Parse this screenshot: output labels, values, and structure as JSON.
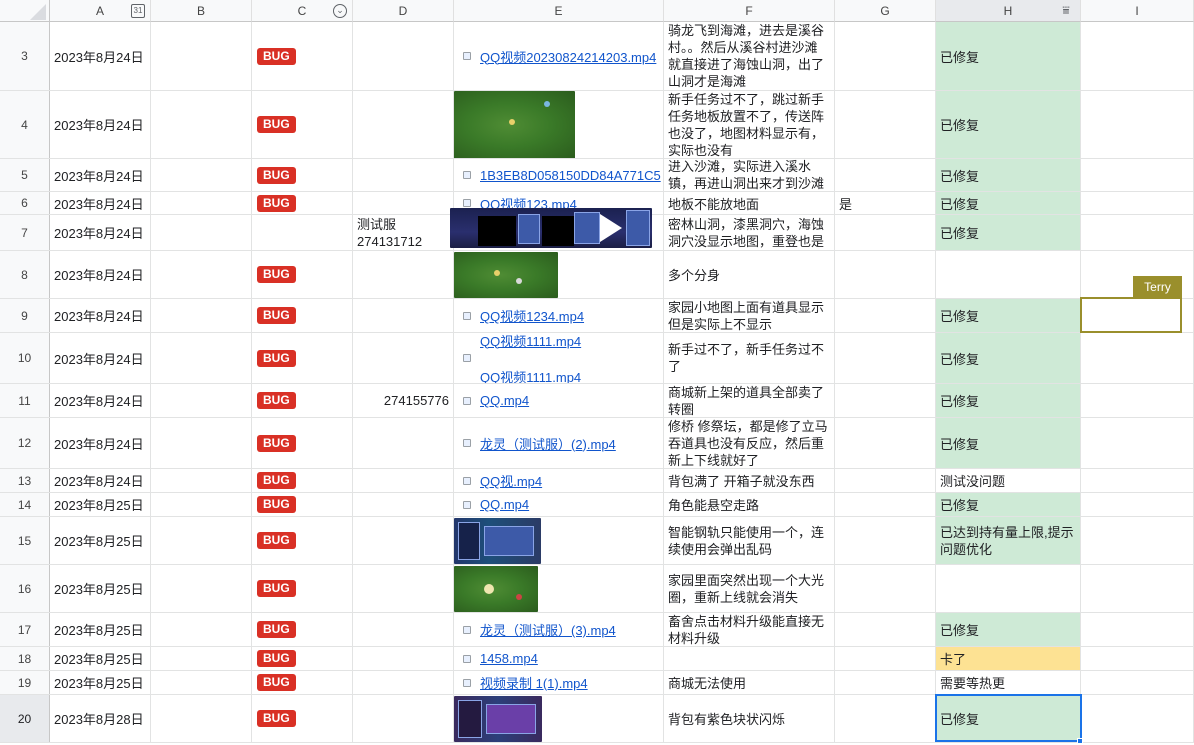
{
  "columns": [
    "A",
    "B",
    "C",
    "D",
    "E",
    "F",
    "G",
    "H",
    "I"
  ],
  "icons": {
    "corner": "select-all-icon",
    "col_a": "calendar-icon",
    "col_c": "chevron-down-icon",
    "col_h": "filter-icon",
    "file": "file-chip-icon"
  },
  "colors": {
    "bug": "#d93025",
    "fixed_green": "#ceead6",
    "stuck_yellow": "#fde293",
    "link": "#1155cc",
    "collab_olive": "#9a8f2c",
    "selection_blue": "#1a73e8"
  },
  "collaborator": {
    "name": "Terry"
  },
  "rows": [
    {
      "num": "3",
      "date": "2023年8月24日",
      "tag": "BUG",
      "d": "",
      "files": [
        "QQ视频20230824214203.mp4"
      ],
      "desc": "骑龙飞到海滩，进去是溪谷村。。然后从溪谷村进沙滩就直接进了海蚀山洞，出了山洞才是海滩",
      "g": "",
      "status": "已修复"
    },
    {
      "num": "4",
      "date": "2023年8月24日",
      "tag": "BUG",
      "d": "",
      "files": [],
      "desc": "新手任务过不了，跳过新手任务地板放置不了，传送阵也没了，地图材料显示有，实际也没有",
      "g": "",
      "status": "已修复"
    },
    {
      "num": "5",
      "date": "2023年8月24日",
      "tag": "BUG",
      "d": "",
      "files": [
        "1B3EB8D058150DD84A771C5"
      ],
      "desc": "进入沙滩，实际进入溪水镇，再进山洞出来才到沙滩",
      "g": "",
      "status": "已修复"
    },
    {
      "num": "6",
      "date": "2023年8月24日",
      "tag": "BUG",
      "d": "",
      "files": [
        "QQ视频123.mp4"
      ],
      "desc": "地板不能放地面",
      "g": "是",
      "status": "已修复"
    },
    {
      "num": "7",
      "date": "2023年8月24日",
      "tag": "",
      "d": "测试服 274131712",
      "files": [],
      "desc": "密林山洞，漆黑洞穴，海蚀洞穴没显示地图，重登也是",
      "g": "",
      "status": "已修复"
    },
    {
      "num": "8",
      "date": "2023年8月24日",
      "tag": "BUG",
      "d": "",
      "files": [],
      "desc": "多个分身",
      "g": "",
      "status": ""
    },
    {
      "num": "9",
      "date": "2023年8月24日",
      "tag": "BUG",
      "d": "",
      "files": [
        "QQ视频1234.mp4"
      ],
      "desc": "家园小地图上面有道具显示但是实际上不显示",
      "g": "",
      "status": "已修复"
    },
    {
      "num": "10",
      "date": "2023年8月24日",
      "tag": "BUG",
      "d": "",
      "files": [
        "QQ视频1111.mp4",
        "QQ视频1111.mp4"
      ],
      "desc": "新手过不了，新手任务过不了",
      "g": "",
      "status": "已修复"
    },
    {
      "num": "11",
      "date": "2023年8月24日",
      "tag": "BUG",
      "d": "274155776",
      "files": [
        "QQ.mp4"
      ],
      "desc": "商城新上架的道具全部卖了转圈",
      "g": "",
      "status": "已修复"
    },
    {
      "num": "12",
      "date": "2023年8月24日",
      "tag": "BUG",
      "d": "",
      "files": [
        "龙灵（测试服）(2).mp4"
      ],
      "desc": "修桥 修祭坛，都是修了立马吞道具也没有反应，然后重新上下线就好了",
      "g": "",
      "status": "已修复"
    },
    {
      "num": "13",
      "date": "2023年8月24日",
      "tag": "BUG",
      "d": "",
      "files": [
        "QQ视.mp4"
      ],
      "desc": "背包满了 开箱子就没东西",
      "g": "",
      "status": "测试没问题"
    },
    {
      "num": "14",
      "date": "2023年8月25日",
      "tag": "BUG",
      "d": "",
      "files": [
        "QQ.mp4"
      ],
      "desc": "角色能悬空走路",
      "g": "",
      "status": "已修复"
    },
    {
      "num": "15",
      "date": "2023年8月25日",
      "tag": "BUG",
      "d": "",
      "files": [],
      "desc": "智能钢轨只能使用一个，连续使用会弹出乱码",
      "g": "",
      "status": "已达到持有量上限,提示问题优化"
    },
    {
      "num": "16",
      "date": "2023年8月25日",
      "tag": "BUG",
      "d": "",
      "files": [],
      "desc": "家园里面突然出现一个大光圈，重新上线就会消失",
      "g": "",
      "status": ""
    },
    {
      "num": "17",
      "date": "2023年8月25日",
      "tag": "BUG",
      "d": "",
      "files": [
        "龙灵（测试服）(3).mp4"
      ],
      "desc": "畜舍点击材料升级能直接无材料升级",
      "g": "",
      "status": "已修复"
    },
    {
      "num": "18",
      "date": "2023年8月25日",
      "tag": "BUG",
      "d": "",
      "files": [
        "1458.mp4"
      ],
      "desc": "",
      "g": "",
      "status": "卡了"
    },
    {
      "num": "19",
      "date": "2023年8月25日",
      "tag": "BUG",
      "d": "",
      "files": [
        "视频录制 1(1).mp4"
      ],
      "desc": "商城无法使用",
      "g": "",
      "status": "需要等热更"
    },
    {
      "num": "20",
      "date": "2023年8月28日",
      "tag": "BUG",
      "d": "",
      "files": [],
      "desc": "背包有紫色块状闪烁",
      "g": "",
      "status": "已修复"
    }
  ]
}
